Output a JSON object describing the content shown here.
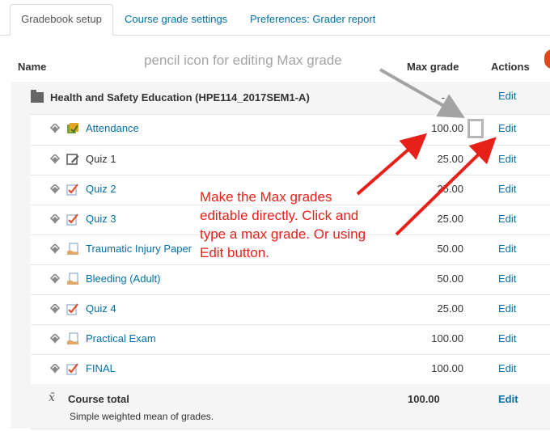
{
  "tabs": [
    {
      "label": "Gradebook setup"
    },
    {
      "label": "Course grade settings"
    },
    {
      "label": "Preferences: Grader report"
    }
  ],
  "table": {
    "headers": {
      "name": "Name",
      "max": "Max grade",
      "actions": "Actions"
    },
    "category": {
      "name": "Health and Safety Education (HPE114_2017SEM1-A)",
      "max": "-",
      "action": "Edit"
    },
    "items": [
      {
        "name": "Attendance",
        "max": "100.00",
        "action": "Edit",
        "icon": "attendance-icon"
      },
      {
        "name": "Quiz 1",
        "max": "25.00",
        "action": "Edit",
        "icon": "edit-manual-icon"
      },
      {
        "name": "Quiz 2",
        "max": "25.00",
        "action": "Edit",
        "icon": "quiz-icon"
      },
      {
        "name": "Quiz 3",
        "max": "25.00",
        "action": "Edit",
        "icon": "quiz-icon"
      },
      {
        "name": "Traumatic Injury Paper",
        "max": "50.00",
        "action": "Edit",
        "icon": "assignment-icon"
      },
      {
        "name": "Bleeding (Adult)",
        "max": "50.00",
        "action": "Edit",
        "icon": "assignment-icon"
      },
      {
        "name": "Quiz 4",
        "max": "25.00",
        "action": "Edit",
        "icon": "quiz-icon"
      },
      {
        "name": "Practical Exam",
        "max": "100.00",
        "action": "Edit",
        "icon": "assignment-icon"
      },
      {
        "name": "FINAL",
        "max": "100.00",
        "action": "Edit",
        "icon": "quiz-icon"
      }
    ],
    "total": {
      "symbol": "x̄",
      "name": "Course total",
      "description": "Simple weighted mean of grades.",
      "max": "100.00",
      "action": "Edit"
    }
  },
  "annotations": {
    "pencil_note": "pencil icon for editing Max grade",
    "red_note_lines": [
      "Make the Max grades",
      "editable directly. Click and",
      "type a max grade. Or using",
      "Edit button."
    ]
  },
  "colors": {
    "link": "#0070a8",
    "annotation_red": "#e8201a",
    "annotation_gray": "#a3a3a3"
  }
}
